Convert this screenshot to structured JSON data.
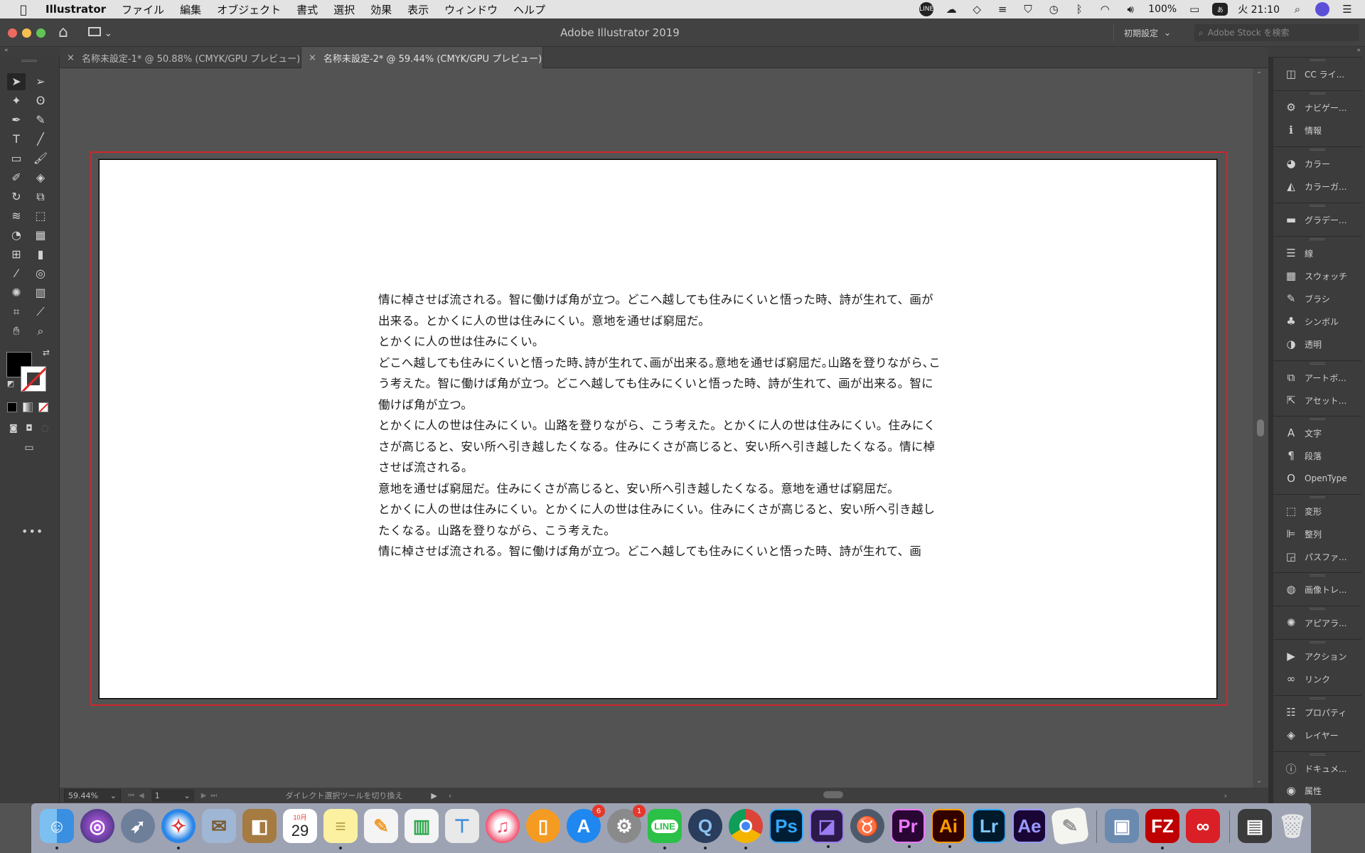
{
  "menubar": {
    "apple": "",
    "app_name": "Illustrator",
    "items": [
      "ファイル",
      "編集",
      "オブジェクト",
      "書式",
      "選択",
      "効果",
      "表示",
      "ウィンドウ",
      "ヘルプ"
    ],
    "status": {
      "line_icon": "LINE",
      "battery": "100%",
      "input_method": "あ",
      "clock": "火 21:10"
    }
  },
  "titlebar": {
    "title": "Adobe Illustrator 2019",
    "workspace": "初期設定",
    "stock_search_placeholder": "Adobe Stock を検索"
  },
  "tabs": [
    {
      "label": "名称未設定-1* @ 50.88% (CMYK/GPU プレビュー)",
      "active": false
    },
    {
      "label": "名称未設定-2* @ 59.44% (CMYK/GPU プレビュー)",
      "active": true
    }
  ],
  "document": {
    "paragraphs": [
      "情に棹させば流される。智に働けば角が立つ。どこへ越しても住みにくいと悟った時、詩が生れて、画が出来る。とかくに人の世は住みにくい。意地を通せば窮屈だ。",
      "とかくに人の世は住みにくい。",
      "どこへ越しても住みにくいと悟った時､詩が生れて､画が出来る｡意地を通せば窮屈だ｡山路を登りながら､こう考えた。智に働けば角が立つ。どこへ越しても住みにくいと悟った時、詩が生れて、画が出来る。智に働けば角が立つ。",
      "とかくに人の世は住みにくい。山路を登りながら、こう考えた。とかくに人の世は住みにくい。住みにくさが高じると、安い所へ引き越したくなる。住みにくさが高じると、安い所へ引き越したくなる。情に棹させば流される。",
      "意地を通せば窮屈だ。住みにくさが高じると、安い所へ引き越したくなる。意地を通せば窮屈だ。",
      "とかくに人の世は住みにくい。とかくに人の世は住みにくい。住みにくさが高じると、安い所へ引き越したくなる。山路を登りながら、こう考えた。",
      "情に棹させば流される。智に働けば角が立つ。どこへ越しても住みにくいと悟った時、詩が生れて、画"
    ]
  },
  "statusbar": {
    "zoom": "59.44%",
    "artboard": "1",
    "tool_hint": "ダイレクト選択ツールを切り換え"
  },
  "panels": [
    [
      {
        "icon": "cc-libraries-icon",
        "label": "CC ライ..."
      }
    ],
    [
      {
        "icon": "navigator-icon",
        "label": "ナビゲー..."
      },
      {
        "icon": "info-icon",
        "label": "情報"
      }
    ],
    [
      {
        "icon": "color-icon",
        "label": "カラー"
      },
      {
        "icon": "color-guide-icon",
        "label": "カラーガ..."
      }
    ],
    [
      {
        "icon": "gradient-icon",
        "label": "グラデー..."
      }
    ],
    [
      {
        "icon": "stroke-icon",
        "label": "線"
      },
      {
        "icon": "swatches-icon",
        "label": "スウォッチ"
      },
      {
        "icon": "brushes-icon",
        "label": "ブラシ"
      },
      {
        "icon": "symbols-icon",
        "label": "シンボル"
      },
      {
        "icon": "transparency-icon",
        "label": "透明"
      }
    ],
    [
      {
        "icon": "artboards-icon",
        "label": "アートボ..."
      },
      {
        "icon": "asset-export-icon",
        "label": "アセット..."
      }
    ],
    [
      {
        "icon": "character-icon",
        "label": "文字"
      },
      {
        "icon": "paragraph-icon",
        "label": "段落"
      },
      {
        "icon": "opentype-icon",
        "label": "OpenType"
      }
    ],
    [
      {
        "icon": "transform-icon",
        "label": "変形"
      },
      {
        "icon": "align-icon",
        "label": "整列"
      },
      {
        "icon": "pathfinder-icon",
        "label": "パスファ..."
      }
    ],
    [
      {
        "icon": "image-trace-icon",
        "label": "画像トレ..."
      }
    ],
    [
      {
        "icon": "appearance-icon",
        "label": "アピアラ..."
      }
    ],
    [
      {
        "icon": "actions-icon",
        "label": "アクション"
      },
      {
        "icon": "links-icon",
        "label": "リンク"
      }
    ],
    [
      {
        "icon": "properties-icon",
        "label": "プロパティ"
      },
      {
        "icon": "layers-icon",
        "label": "レイヤー"
      }
    ],
    [
      {
        "icon": "document-info-icon",
        "label": "ドキュメ..."
      },
      {
        "icon": "attributes-icon",
        "label": "属性"
      }
    ]
  ],
  "dock": {
    "calendar_month": "10月",
    "calendar_day": "29",
    "appstore_badge": "6",
    "sysprefs_badge": "1",
    "line_label": "LINE",
    "ps_label": "Ps",
    "pr_label": "Pr",
    "ai_label": "Ai",
    "lr_label": "Lr",
    "ae_label": "Ae",
    "fz_label": "FZ"
  },
  "colors": {
    "accent_red": "#d0262d",
    "ui_dark": "#3c3c3c",
    "canvas_bg": "#535353"
  }
}
